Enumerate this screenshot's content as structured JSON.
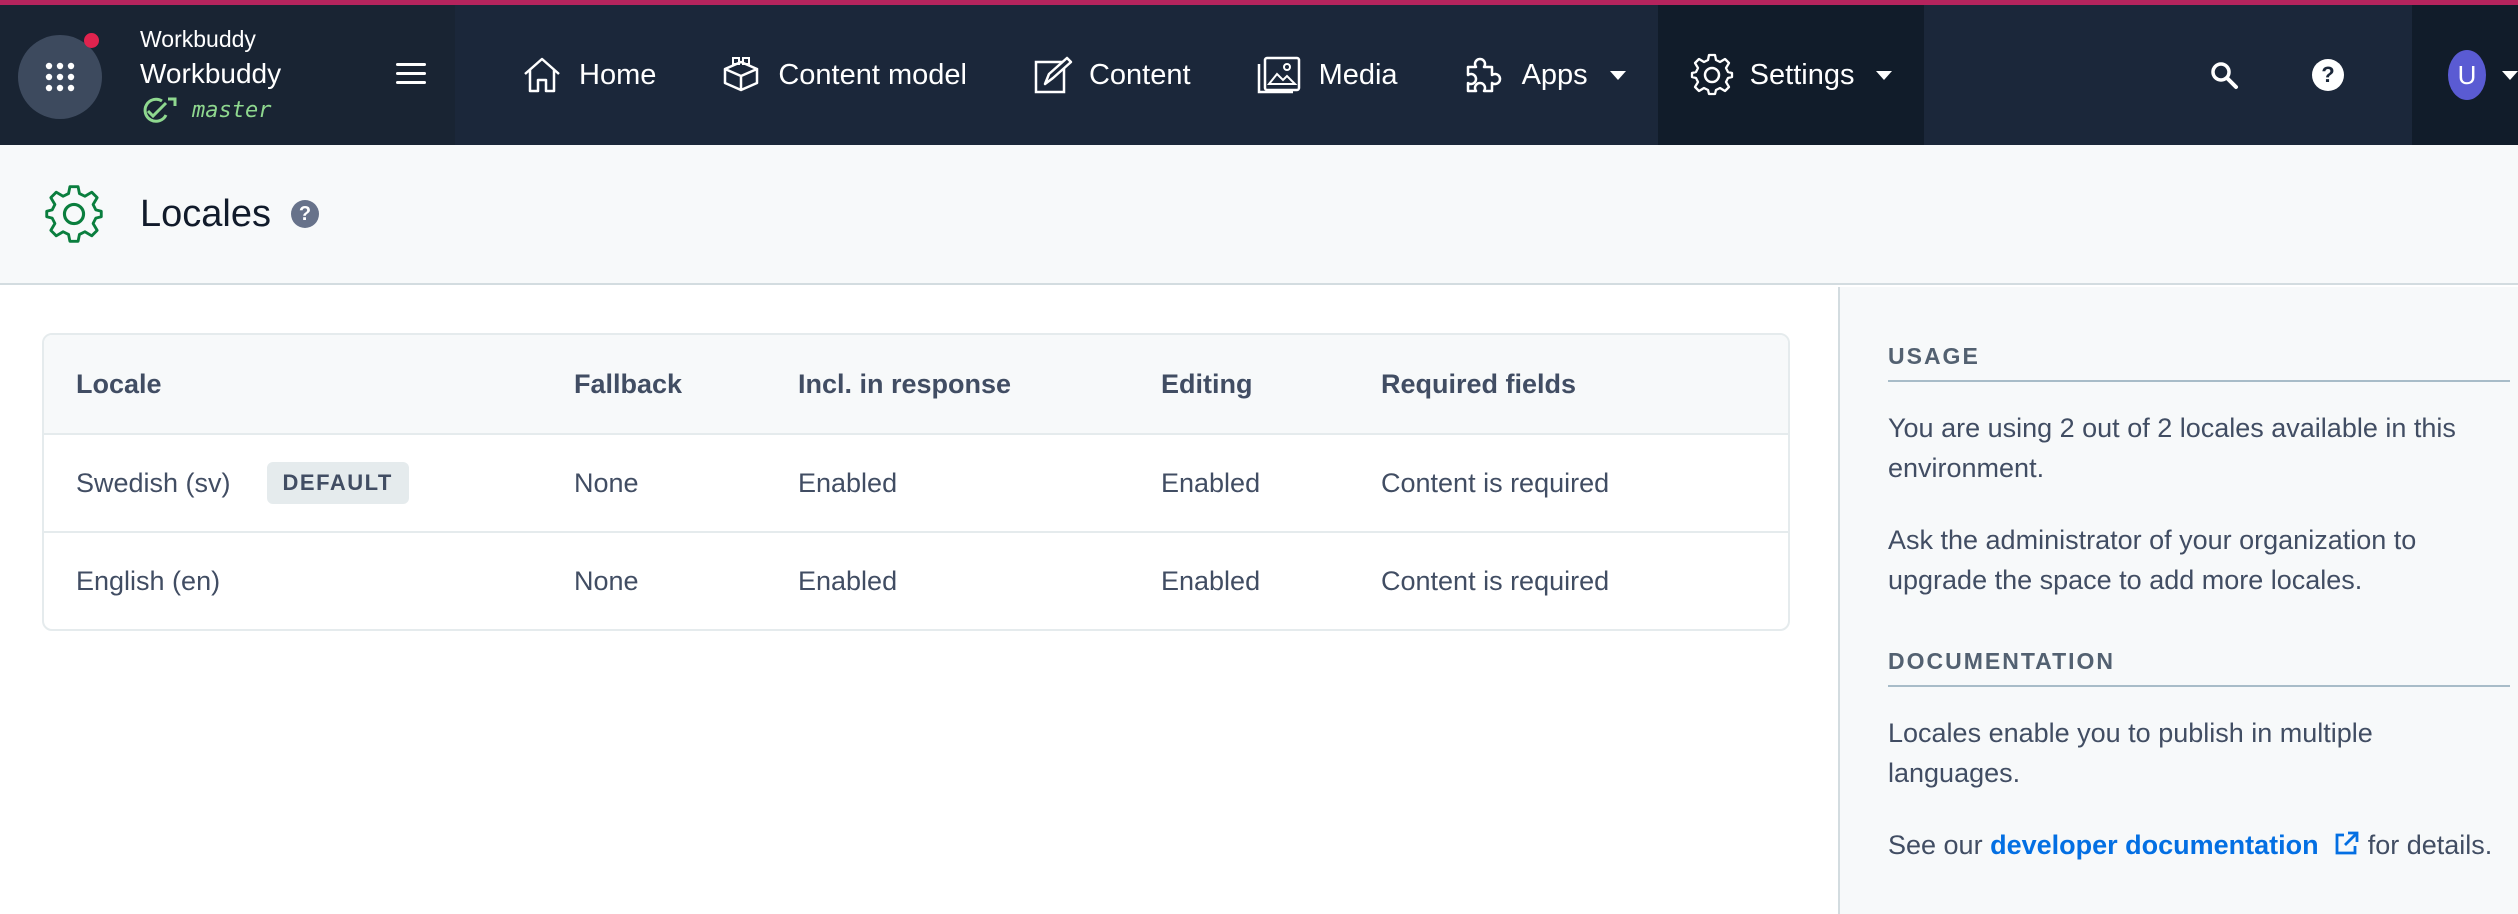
{
  "topbar": {
    "org_name": "Workbuddy",
    "space_name": "Workbuddy",
    "environment": "master",
    "nav": {
      "home": "Home",
      "content_model": "Content model",
      "content": "Content",
      "media": "Media",
      "apps": "Apps",
      "settings": "Settings"
    },
    "user_initial": "U"
  },
  "page": {
    "title": "Locales",
    "help": "?"
  },
  "table": {
    "headers": {
      "locale": "Locale",
      "fallback": "Fallback",
      "incl": "Incl. in response",
      "editing": "Editing",
      "required": "Required fields"
    },
    "rows": [
      {
        "locale": "Swedish (sv)",
        "badge": "DEFAULT",
        "fallback": "None",
        "incl": "Enabled",
        "editing": "Enabled",
        "required": "Content is required"
      },
      {
        "locale": "English (en)",
        "fallback": "None",
        "incl": "Enabled",
        "editing": "Enabled",
        "required": "Content is required"
      }
    ]
  },
  "sidebar": {
    "usage_heading": "USAGE",
    "usage_p1": "You are using 2 out of 2 locales available in this environment.",
    "usage_p2": "Ask the administrator of your organization to upgrade the space to add more locales.",
    "docs_heading": "DOCUMENTATION",
    "docs_p1": "Locales enable you to publish in multiple languages.",
    "docs_see": "See our",
    "docs_link": "developer documentation",
    "docs_after": "for details."
  },
  "colors": {
    "accent": "#b5245d",
    "nav_bg": "#1b273a",
    "link": "#036fe3",
    "env_green": "#8fd88f",
    "settings_gear": "#0a7e3e"
  }
}
